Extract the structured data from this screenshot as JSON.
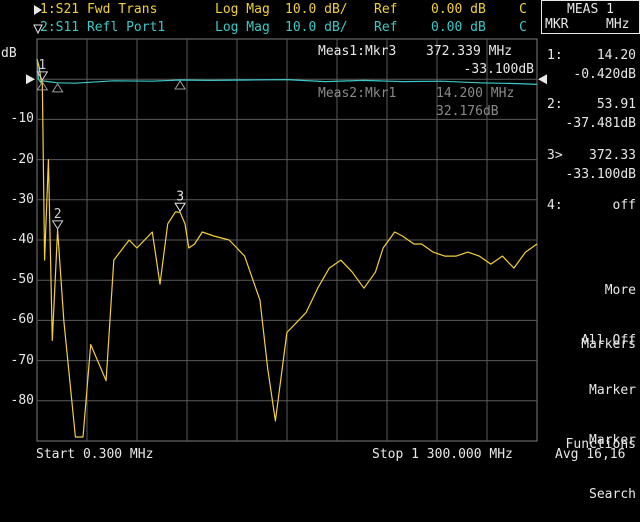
{
  "header": {
    "trace1": {
      "label": "1:S21 Fwd Trans",
      "format": "Log Mag",
      "scale": "10.0 dB/",
      "ref_label": "Ref",
      "ref_value": "0.00 dB",
      "flag": "C"
    },
    "trace2": {
      "label": "2:S11 Refl Port1",
      "format": "Log Mag",
      "scale": "10.0 dB/",
      "ref_label": "Ref",
      "ref_value": "0.00 dB",
      "flag": "C"
    }
  },
  "unit_label": "dB",
  "readouts": {
    "meas1": {
      "label": "Meas1:Mkr3",
      "freq": "372.339 MHz",
      "value": "-33.100dB"
    },
    "meas2": {
      "label": "Meas2:Mkr1",
      "freq": "14.200 MHz",
      "value": "32.176dB"
    }
  },
  "footer": {
    "start": "Start 0.300 MHz",
    "stop": "Stop 1 300.000 MHz"
  },
  "softkeys": {
    "title": "MEAS 1",
    "col1": "MKR",
    "col2": "MHz",
    "marker_list": [
      {
        "id": "1:",
        "freq": "14.20",
        "value": "-0.420dB"
      },
      {
        "id": "2:",
        "freq": "53.91",
        "value": "-37.481dB"
      },
      {
        "id": "3>",
        "freq": "372.33",
        "value": "-33.100dB"
      },
      {
        "id": "4:",
        "freq": "off",
        "value": ""
      }
    ],
    "more_markers_1": "More",
    "more_markers_2": "Markers",
    "all_off": "All Off",
    "marker_functions_1": "Marker",
    "marker_functions_2": "Functions",
    "marker_search_1": "Marker",
    "marker_search_2": "Search",
    "avg": "Avg 16,16"
  },
  "chart_data": {
    "type": "line",
    "xlabel": "",
    "ylabel": "dB",
    "xlim": [
      0.3,
      1300
    ],
    "ylim": [
      -90,
      10
    ],
    "grid": true,
    "y_ticks": [
      "-10",
      "-20",
      "-30",
      "-40",
      "-50",
      "-60",
      "-70",
      "-80"
    ],
    "colors": {
      "s21": "#f4cf3a",
      "s11": "#3cc8c8",
      "grid": "#5a5a5a"
    },
    "series": [
      {
        "name": "S21 Fwd Trans",
        "x": [
          0.3,
          6,
          12,
          14.2,
          20,
          30,
          40,
          53.91,
          70,
          100,
          120,
          140,
          180,
          200,
          240,
          260,
          300,
          320,
          340,
          360,
          372.339,
          385,
          395,
          410,
          430,
          460,
          500,
          540,
          580,
          600,
          620,
          650,
          680,
          700,
          730,
          760,
          790,
          820,
          850,
          880,
          900,
          930,
          950,
          980,
          1000,
          1030,
          1060,
          1090,
          1120,
          1150,
          1180,
          1210,
          1240,
          1270,
          1300
        ],
        "y": [
          5,
          3,
          -1,
          -0.42,
          -45,
          -20,
          -65,
          -37.48,
          -60,
          -89,
          -89,
          -66,
          -75,
          -45,
          -40,
          -42,
          -38,
          -51,
          -36,
          -33,
          -33.1,
          -36,
          -42,
          -41,
          -38,
          -39,
          -40,
          -44,
          -55,
          -72,
          -85,
          -63,
          -60,
          -58,
          -52,
          -47,
          -45,
          -48,
          -52,
          -48,
          -42,
          -38,
          -39,
          -41,
          -41,
          -43,
          -44,
          -44,
          -43,
          -44,
          -46,
          -44,
          -47,
          -43,
          -41
        ]
      },
      {
        "name": "S11 Refl Port1",
        "x": [
          0.3,
          2,
          4,
          10,
          14.2,
          30,
          53.91,
          100,
          200,
          300,
          372.339,
          450,
          550,
          650,
          750,
          850,
          950,
          1050,
          1150,
          1250,
          1300
        ],
        "y": [
          5,
          3,
          0,
          -0.8,
          -0.42,
          -0.6,
          -0.9,
          -1.0,
          -0.4,
          -0.5,
          -0.2,
          -0.3,
          -0.2,
          -0.1,
          -0.6,
          -0.3,
          -0.6,
          -0.5,
          -0.9,
          -1.1,
          -1.3
        ]
      }
    ],
    "markers": [
      {
        "id": "1",
        "x": 14.2,
        "y": -0.42,
        "trace": "S11"
      },
      {
        "id": "2",
        "x": 53.91,
        "y": -37.481,
        "trace": "S21"
      },
      {
        "id": "3",
        "x": 372.339,
        "y": -33.1,
        "trace": "S21"
      }
    ]
  }
}
